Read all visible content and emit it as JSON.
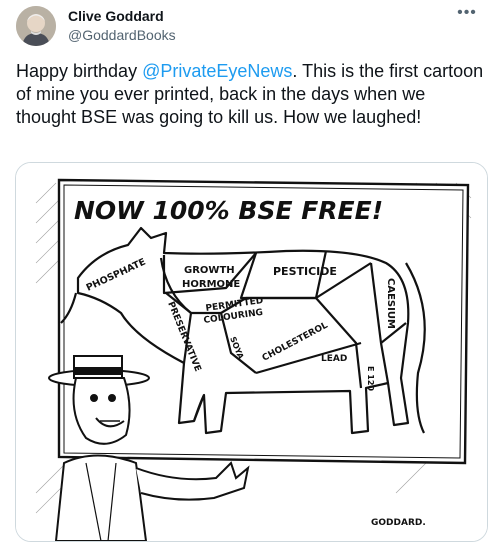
{
  "author": {
    "name": "Clive Goddard",
    "handle": "@GoddardBooks"
  },
  "more_icon": "more-horizontal-icon",
  "tweet": {
    "text_pre": "Happy birthday ",
    "mention": "@PrivateEyeNews",
    "text_post": ". This is the first cartoon of mine you ever printed, back in the days when we thought BSE was going to kill us. How we laughed!"
  },
  "cartoon": {
    "banner": "NOW 100% BSE FREE!",
    "labels": {
      "phosphate": "PHOSPHATE",
      "growth": "GROWTH",
      "hormone": "HORMONE",
      "pesticide": "PESTICIDE",
      "permitted": "PERMITTED",
      "colouring": "COLOURING",
      "preservative": "PRESERVATIVE",
      "soya": "SOYA",
      "cholesterol": "CHOLESTEROL",
      "lead": "LEAD",
      "caesium": "CAESIUM",
      "e120": "E 120"
    },
    "signature": "GODDARD."
  }
}
